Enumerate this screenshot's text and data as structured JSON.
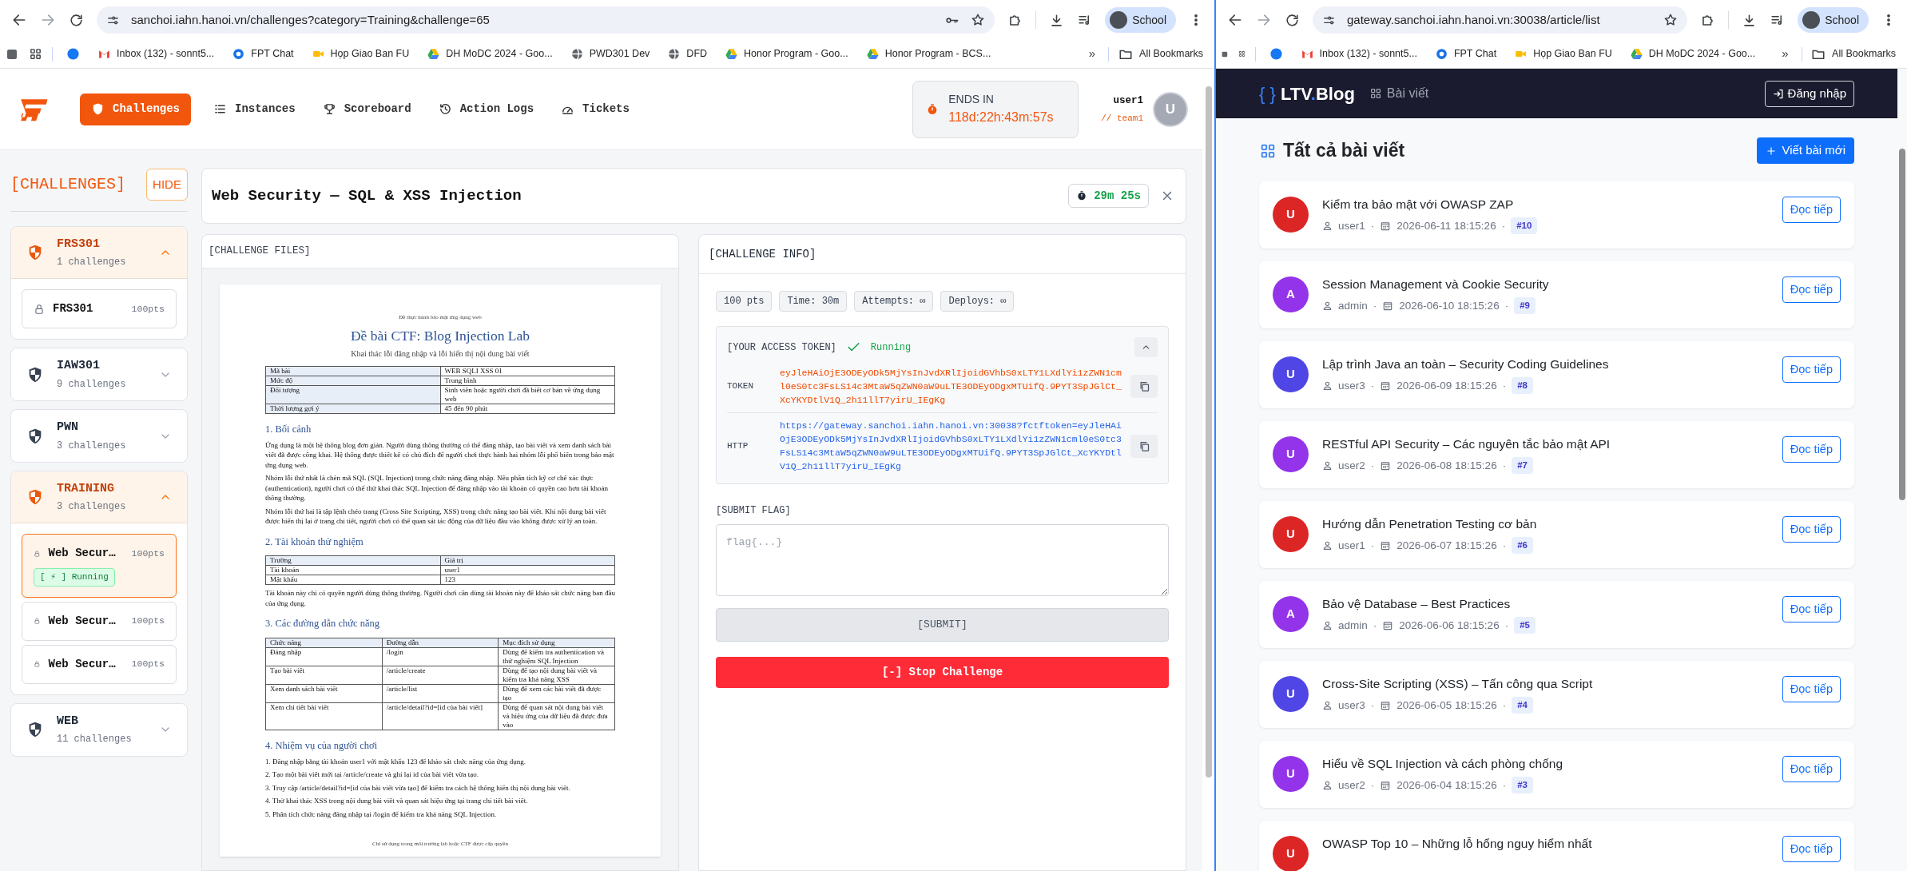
{
  "left_browser": {
    "address": "sanchoi.iahn.hanoi.vn/challenges?category=Training&challenge=65",
    "key_icon": true,
    "profile": "School",
    "bookmarks": [
      {
        "kind": "facebook"
      },
      {
        "kind": "gmail",
        "label": "Inbox (132) - sonnt5..."
      },
      {
        "kind": "chat",
        "label": "FPT Chat"
      },
      {
        "kind": "meet",
        "label": "Họp Giao Ban FU"
      },
      {
        "kind": "drive",
        "label": "DH MoDC 2024 - Goo..."
      },
      {
        "kind": "globe",
        "label": "PWD301 Dev"
      },
      {
        "kind": "globe",
        "label": "DFD"
      },
      {
        "kind": "drive",
        "label": "Honor Program - Goo..."
      },
      {
        "kind": "drive",
        "label": "Honor Program - BCS..."
      }
    ],
    "more": "»",
    "all_bookmarks": "All Bookmarks"
  },
  "ctf_page": {
    "nav": [
      {
        "label": "Challenges",
        "kind": "shield",
        "selected": true
      },
      {
        "label": "Instances",
        "kind": "list",
        "selected": false
      },
      {
        "label": "Scoreboard",
        "kind": "trophy",
        "selected": false
      },
      {
        "label": "Action Logs",
        "kind": "history",
        "selected": false
      },
      {
        "label": "Tickets",
        "kind": "ticket",
        "selected": false
      }
    ],
    "ends_label": "ENDS IN",
    "countdown": "118d:22h:43m:57s",
    "user": "user1",
    "team": "// team1",
    "avatar": "U",
    "sidebar": {
      "title": "[CHALLENGES]",
      "hide": "HIDE",
      "categories": [
        {
          "name": "FRS301",
          "count": "1 challenges",
          "expanded": true,
          "challenges": [
            {
              "name": "FRS301",
              "points": "100pts",
              "selected": false
            }
          ]
        },
        {
          "name": "IAW301",
          "count": "9 challenges",
          "expanded": false
        },
        {
          "name": "PWN",
          "count": "3 challenges",
          "expanded": false
        },
        {
          "name": "TRAINING",
          "count": "3 challenges",
          "expanded": true,
          "challenges": [
            {
              "name": "Web Secur…",
              "points": "100pts",
              "selected": true,
              "status": "[ ⚡ ] Running"
            },
            {
              "name": "Web Secur…",
              "points": "100pts",
              "selected": false
            },
            {
              "name": "Web Secur…",
              "points": "100pts",
              "selected": false
            }
          ]
        },
        {
          "name": "WEB",
          "count": "11 challenges",
          "expanded": false
        }
      ]
    },
    "challenge": {
      "title": "Web Security — SQL & XSS Injection",
      "timer": "29m 25s"
    },
    "files": {
      "header": "[CHALLENGE FILES]",
      "document": {
        "note": "Đề thực hành bảo mật ứng dụng web",
        "title": "Đề bài CTF: Blog Injection Lab",
        "subtitle": "Khai thác lỗi đăng nhập và lỗi hiển thị nội dung bài viết",
        "blocks": [
          {
            "kind": "table",
            "first_row_shaded": false,
            "first_column_shaded": true,
            "rows": [
              [
                "Mã bài",
                "WEB SQLI XSS 01"
              ],
              [
                "Mức độ",
                "Trung bình"
              ],
              [
                "Đối tượng",
                "Sinh viên hoặc người chơi đã biết cơ bản về ứng dụng web"
              ],
              [
                "Thời lượng gợi ý",
                "45 đến 90 phút"
              ]
            ]
          },
          {
            "kind": "heading",
            "text": "1. Bối cảnh"
          },
          {
            "kind": "paragraph",
            "text": "Ứng dụng là một hệ thống blog đơn giản. Người dùng thông thường có thể đăng nhập, tạo bài viết và xem danh sách bài viết đã được công khai. Hệ thống được thiết kế có chủ đích để người chơi thực hành hai nhóm lỗi phổ biến trong bảo mật ứng dụng web."
          },
          {
            "kind": "paragraph",
            "text": "Nhóm lỗi thứ nhất là chèn mã SQL (SQL Injection) trong chức năng đăng nhập. Nếu phân tích kỹ cơ chế xác thực (authentication), người chơi có thể thử khai thác SQL Injection để đăng nhập vào tài khoản có quyền cao hơn tài khoản thông thường."
          },
          {
            "kind": "paragraph",
            "text": "Nhóm lỗi thứ hai là tập lệnh chéo trang (Cross Site Scripting, XSS) trong chức năng tạo bài viết. Khi nội dung bài viết được hiển thị lại ở trang chi tiết, người chơi có thể quan sát tác động của dữ liệu đầu vào không được xử lý an toàn."
          },
          {
            "kind": "heading",
            "text": "2. Tài khoản thử nghiệm"
          },
          {
            "kind": "table",
            "first_row_shaded": true,
            "first_column_shaded": false,
            "rows": [
              [
                "Trường",
                "Giá trị"
              ],
              [
                "Tài khoản",
                "user1"
              ],
              [
                "Mật khẩu",
                "123"
              ]
            ]
          },
          {
            "kind": "paragraph",
            "text": "Tài khoản này chỉ có quyền người dùng thông thường. Người chơi cần dùng tài khoản này để khảo sát chức năng ban đầu của ứng dụng."
          },
          {
            "kind": "heading",
            "text": "3. Các đường dẫn chức năng"
          },
          {
            "kind": "table",
            "first_row_shaded": true,
            "first_column_shaded": false,
            "rows": [
              [
                "Chức năng",
                "Đường dẫn",
                "Mục đích sử dụng"
              ],
              [
                "Đăng nhập",
                "/login",
                "Dùng để kiểm tra authentication và thử nghiệm SQL Injection"
              ],
              [
                "Tạo bài viết",
                "/article/create",
                "Dùng để tạo nội dung bài viết và kiểm tra khả năng XSS"
              ],
              [
                "Xem danh sách bài viết",
                "/article/list",
                "Dùng để xem các bài viết đã được tạo"
              ],
              [
                "Xem chi tiết bài viết",
                "/article/detail?id=[id của bài viết]",
                "Dùng để quan sát nội dung bài viết và hiệu ứng của dữ liệu đã được đưa vào"
              ]
            ]
          },
          {
            "kind": "heading",
            "text": "4. Nhiệm vụ của người chơi"
          },
          {
            "kind": "paragraph",
            "text": "1. Đăng nhập bằng tài khoản user1 với mật khẩu 123 để khảo sát chức năng của ứng dụng."
          },
          {
            "kind": "paragraph",
            "text": "2. Tạo một bài viết mới tại /article/create và ghi lại id của bài viết vừa tạo."
          },
          {
            "kind": "paragraph",
            "text": "3. Truy cập /article/detail?id=[id của bài viết vừa tạo] để kiểm tra cách hệ thống hiển thị nội dung bài viết."
          },
          {
            "kind": "paragraph",
            "text": "4. Thử khai thác XSS trong nội dung bài viết và quan sát hiệu ứng tại trang chi tiết bài viết."
          },
          {
            "kind": "paragraph",
            "text": "5. Phân tích chức năng đăng nhập tại /login để kiểm tra khả năng SQL Injection."
          }
        ],
        "footer": "Chỉ sử dụng trong môi trường lab hoặc CTF được cấp quyền"
      }
    },
    "info": {
      "header": "[CHALLENGE INFO]",
      "chips": [
        "100 pts",
        "Time: 30m",
        "Attempts: ∞",
        "Deploys: ∞"
      ],
      "token_title": "[YOUR ACCESS TOKEN]",
      "token_status": "Running",
      "rows": [
        {
          "kind": "token",
          "label": "TOKEN",
          "value": "eyJleHAiOjE3ODEyODk5MjYsInJvdXRlIjoidGVhbS0xLTY1LXdlYi1zZWN1cml0eS0tc3FsLS14c3MtaW5qZWN0aW9uLTE3ODEyODgxMTUifQ.9PYT3SpJGlCt_XcYKYDtlV1Q_2h11llT7yirU_IEgKg"
        },
        {
          "kind": "link",
          "label": "HTTP",
          "value": "https://gateway.sanchoi.iahn.hanoi.vn:30038?fctftoken=eyJleHAiOjE3ODEyODk5MjYsInJvdXRlIjoidGVhbS0xLTY1LXdlYi1zZWN1cml0eS0tc3FsLS14c3MtaW5qZWN0aW9uLTE3ODEyODgxMTUifQ.9PYT3SpJGlCt_XcYKYDtlV1Q_2h11llT7yirU_IEgKg"
        }
      ],
      "flag_label": "[SUBMIT FLAG]",
      "flag_placeholder": "flag{...}",
      "submit": "[SUBMIT]",
      "stop": "[-] Stop Challenge"
    }
  },
  "right_browser": {
    "address": "gateway.sanchoi.iahn.hanoi.vn:30038/article/list",
    "key_icon": false,
    "profile": "School",
    "bookmarks": [
      {
        "kind": "facebook"
      },
      {
        "kind": "gmail",
        "label": "Inbox (132) - sonnt5..."
      },
      {
        "kind": "chat",
        "label": "FPT Chat"
      },
      {
        "kind": "meet",
        "label": "Họp Giao Ban FU"
      },
      {
        "kind": "drive",
        "label": "DH MoDC 2024 - Goo..."
      }
    ],
    "more": "»",
    "all_bookmarks": "All Bookmarks"
  },
  "blog_page": {
    "logo": {
      "brace": "{ }",
      "name": "LTV",
      "dot": ".",
      "rest": "Blog"
    },
    "nav": "Bài viết",
    "login": "Đăng nhập",
    "heading": "Tất cả bài viết",
    "new_post": "Viết bài mới",
    "separator": "·",
    "articles": [
      {
        "avatar": "U",
        "color": "#dc2626",
        "title": "Kiểm tra bảo mật với OWASP ZAP",
        "author": "user1",
        "date": "2026-06-11 18:15:26",
        "id": "#10",
        "read_more": "Đọc tiếp"
      },
      {
        "avatar": "A",
        "color": "#9333ea",
        "title": "Session Management và Cookie Security",
        "author": "admin",
        "date": "2026-06-10 18:15:26",
        "id": "#9",
        "read_more": "Đọc tiếp"
      },
      {
        "avatar": "U",
        "color": "#4f46e5",
        "title": "Lập trình Java an toàn – Security Coding Guidelines",
        "author": "user3",
        "date": "2026-06-09 18:15:26",
        "id": "#8",
        "read_more": "Đọc tiếp"
      },
      {
        "avatar": "U",
        "color": "#9333ea",
        "title": "RESTful API Security – Các nguyên tắc bảo mật API",
        "author": "user2",
        "date": "2026-06-08 18:15:26",
        "id": "#7",
        "read_more": "Đọc tiếp"
      },
      {
        "avatar": "U",
        "color": "#dc2626",
        "title": "Hướng dẫn Penetration Testing cơ bản",
        "author": "user1",
        "date": "2026-06-07 18:15:26",
        "id": "#6",
        "read_more": "Đọc tiếp"
      },
      {
        "avatar": "A",
        "color": "#9333ea",
        "title": "Bảo vệ Database – Best Practices",
        "author": "admin",
        "date": "2026-06-06 18:15:26",
        "id": "#5",
        "read_more": "Đọc tiếp"
      },
      {
        "avatar": "U",
        "color": "#4f46e5",
        "title": "Cross-Site Scripting (XSS) – Tấn công qua Script",
        "author": "user3",
        "date": "2026-06-05 18:15:26",
        "id": "#4",
        "read_more": "Đọc tiếp"
      },
      {
        "avatar": "U",
        "color": "#9333ea",
        "title": "Hiểu về SQL Injection và cách phòng chống",
        "author": "user2",
        "date": "2026-06-04 18:15:26",
        "id": "#3",
        "read_more": "Đọc tiếp"
      },
      {
        "avatar": "U",
        "color": "#dc2626",
        "title": "OWASP Top 10 – Những lỗ hổng nguy hiểm nhất",
        "read_more": "Đọc tiếp"
      }
    ]
  }
}
